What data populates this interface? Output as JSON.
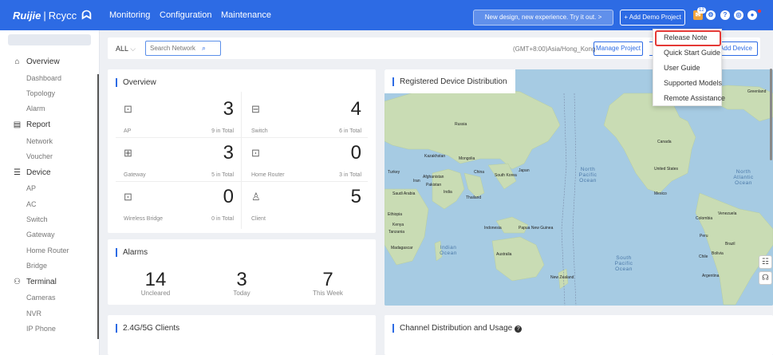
{
  "header": {
    "logo_brand": "Ruijie",
    "logo_sep": "|",
    "logo_product": "Rcycc",
    "nav": [
      "Monitoring",
      "Configuration",
      "Maintenance"
    ],
    "promo": "New design, new experience. Try it out. >",
    "add_demo": "+ Add Demo Project",
    "msg_count": "12"
  },
  "sidebar": {
    "groups": [
      {
        "label": "Overview",
        "items": [
          "Dashboard",
          "Topology",
          "Alarm"
        ]
      },
      {
        "label": "Report",
        "items": [
          "Network",
          "Voucher"
        ]
      },
      {
        "label": "Device",
        "items": [
          "AP",
          "AC",
          "Switch",
          "Gateway",
          "Home Router",
          "Bridge"
        ]
      },
      {
        "label": "Terminal",
        "items": [
          "Cameras",
          "NVR",
          "IP Phone"
        ]
      }
    ]
  },
  "filter": {
    "scope": "ALL",
    "search_placeholder": "Search Network",
    "timezone": "(GMT+8:00)Asia/Hong_Kong",
    "manage_project": "Manage Project",
    "add_device": "Add Device"
  },
  "overview": {
    "title": "Overview",
    "cells": [
      {
        "label": "AP",
        "count": "3",
        "total": "9 in Total"
      },
      {
        "label": "Switch",
        "count": "4",
        "total": "6 in Total"
      },
      {
        "label": "Gateway",
        "count": "3",
        "total": "5 in Total"
      },
      {
        "label": "Home Router",
        "count": "0",
        "total": "3 in Total"
      },
      {
        "label": "Wireless Bridge",
        "count": "0",
        "total": "0 in Total"
      },
      {
        "label": "Client",
        "count": "5",
        "total": ""
      }
    ]
  },
  "alarms": {
    "title": "Alarms",
    "items": [
      {
        "label": "Uncleared",
        "value": "14"
      },
      {
        "label": "Today",
        "value": "3"
      },
      {
        "label": "This Week",
        "value": "7"
      }
    ]
  },
  "map": {
    "title": "Registered Device Distribution",
    "oceans": {
      "north_pacific": [
        "North",
        "Pacific",
        "Ocean"
      ],
      "north_atlantic": [
        "North",
        "Atlantic",
        "Ocean"
      ],
      "indian": [
        "Indian",
        "Ocean"
      ],
      "south_pacific": [
        "South",
        "Pacific",
        "Ocean"
      ]
    },
    "places": [
      "Greenland",
      "Russia",
      "Canada",
      "United States",
      "Mexico",
      "Venezuela",
      "Colombia",
      "Peru",
      "Brazil",
      "Bolivia",
      "Chile",
      "Argentina",
      "Kazakhstan",
      "Mongolia",
      "China",
      "South Korea",
      "Japan",
      "Turkey",
      "Afghanistan",
      "Iran",
      "Pakistan",
      "India",
      "Saudi Arabia",
      "Thailand",
      "Ethiopia",
      "Kenya",
      "Tanzania",
      "Indonesia",
      "Papua New Guinea",
      "Madagascar",
      "Australia",
      "New Zealand"
    ]
  },
  "clients": {
    "title": "2.4G/5G Clients"
  },
  "channel": {
    "title": "Channel Distribution and Usage",
    "help": "?"
  },
  "dropdown": {
    "items": [
      "Release Note",
      "Quick Start Guide",
      "User Guide",
      "Supported Models",
      "Remote Assistance"
    ],
    "highlighted": "Release Note",
    "highlight_color": "#e53935"
  },
  "colors": {
    "accent": "#2d6be4",
    "land": "#c9dcb4",
    "water": "#a6cbe3"
  }
}
